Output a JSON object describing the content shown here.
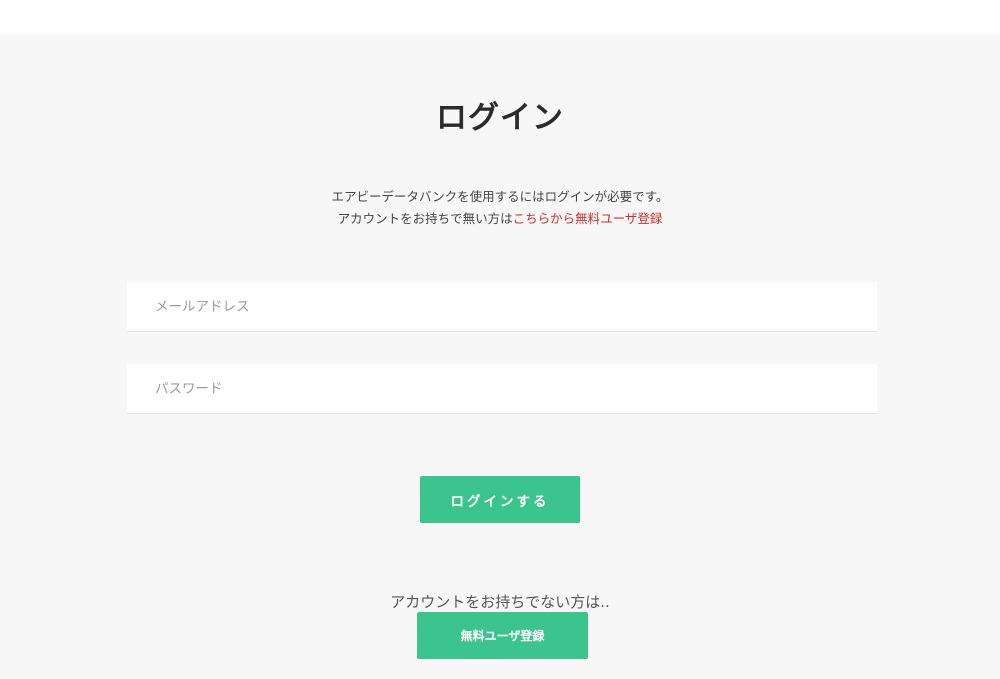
{
  "page": {
    "title": "ログイン"
  },
  "intro": {
    "line1": "エアビーデータバンクを使用するにはログインが必要です。",
    "line2_prefix": "アカウントをお持ちで無い方は",
    "register_link": "こちらから無料ユーザ登録"
  },
  "form": {
    "email_placeholder": "メールアドレス",
    "email_value": "",
    "password_placeholder": "パスワード",
    "password_value": "",
    "login_button": "ログインする"
  },
  "signup": {
    "prompt": "アカウントをお持ちでない方は..",
    "register_button": "無料ユーザ登録"
  },
  "colors": {
    "accent_green": "#3cc48f",
    "link_red": "#c8312c",
    "background": "#f7f7f7"
  }
}
